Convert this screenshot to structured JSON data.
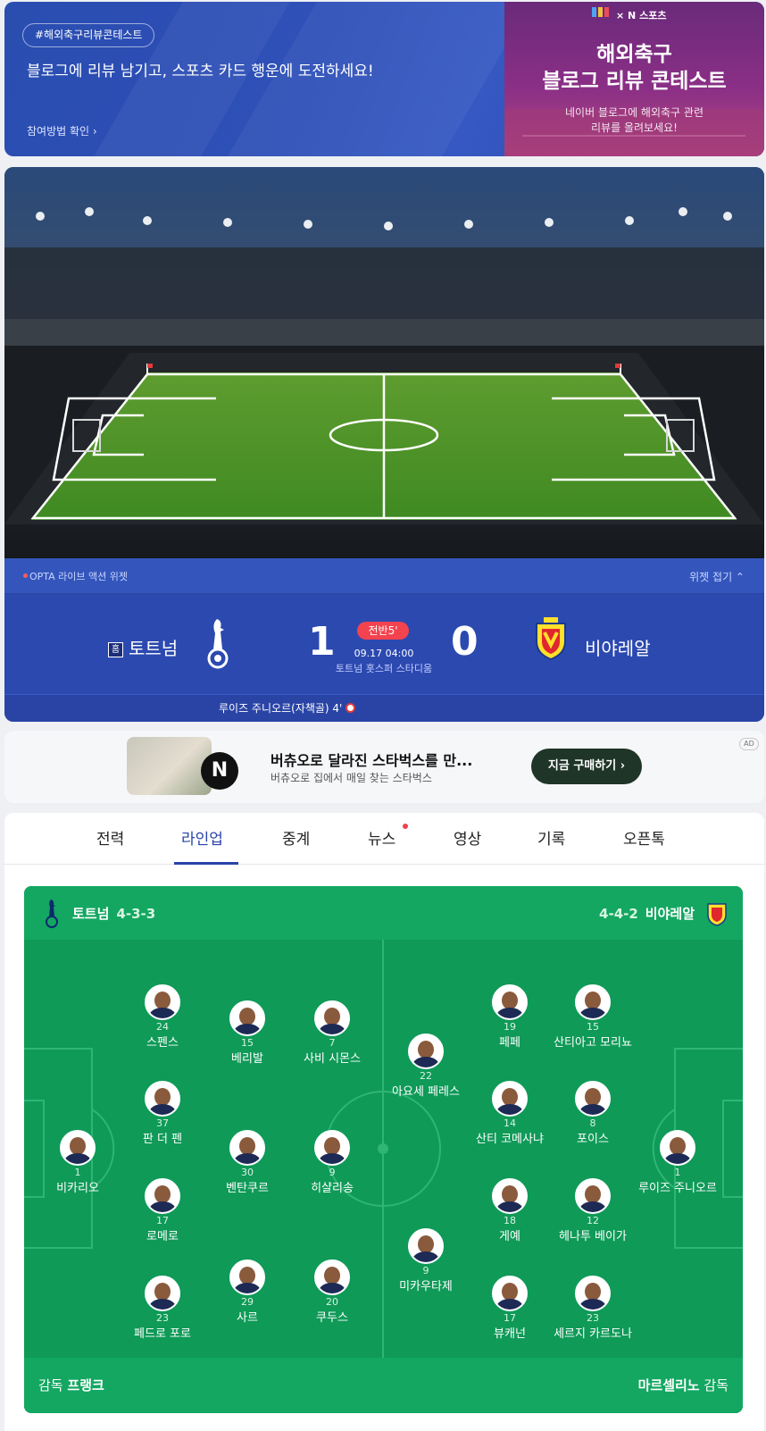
{
  "banner": {
    "tag": "#해외축구리뷰콘테스트",
    "headline": "블로그에 리뷰 남기고, 스포츠 카드 행운에 도전하세요!",
    "link": "참여방법 확인 ›",
    "promo_brand": "× N 스포츠",
    "promo_title_1": "해외축구",
    "promo_title_2": "블로그 리뷰 콘테스트",
    "promo_sub_1": "네이버 블로그에 해외축구 관련",
    "promo_sub_2": "리뷰를 올려보세요!"
  },
  "widget": {
    "label": "OPTA 라이브 액션 위젯",
    "fold": "위젯 접기 ⌃"
  },
  "match": {
    "home_badge": "홈",
    "home_team": "토트넘",
    "away_team": "비야레알",
    "home_score": "1",
    "away_score": "0",
    "status": "전반5'",
    "kickoff": "09.17 04:00",
    "venue": "토트넘 홋스퍼 스타디움",
    "scorer": "루이즈 주니오르(자책골) 4'"
  },
  "ad": {
    "title": "버츄오로 달라진 스타벅스를 만...",
    "desc": "버츄오로 집에서 매일 찾는 스타벅스",
    "button": "지금 구매하기 ›",
    "tag": "AD",
    "logo": "N"
  },
  "tabs": [
    "전력",
    "라인업",
    "중계",
    "뉴스",
    "영상",
    "기록",
    "오픈톡"
  ],
  "active_tab": "라인업",
  "lineup": {
    "home_team": "토트넘",
    "home_formation": "4-3-3",
    "away_team": "비야레알",
    "away_formation": "4-4-2",
    "home_coach_label": "감독",
    "home_coach": "프랭크",
    "away_coach_label": "감독",
    "away_coach": "마르셀리노",
    "home_players": [
      {
        "number": "24",
        "name": "스펜스"
      },
      {
        "number": "15",
        "name": "베리발"
      },
      {
        "number": "7",
        "name": "사비 시몬스"
      },
      {
        "number": "37",
        "name": "판 더 펜"
      },
      {
        "number": "1",
        "name": "비카리오"
      },
      {
        "number": "30",
        "name": "벤탄쿠르"
      },
      {
        "number": "9",
        "name": "히샬리송"
      },
      {
        "number": "17",
        "name": "로메로"
      },
      {
        "number": "29",
        "name": "사르"
      },
      {
        "number": "20",
        "name": "쿠두스"
      },
      {
        "number": "23",
        "name": "페드로 포로"
      }
    ],
    "away_players": [
      {
        "number": "19",
        "name": "페페"
      },
      {
        "number": "15",
        "name": "산티아고 모리뇨"
      },
      {
        "number": "22",
        "name": "아요세 페레스"
      },
      {
        "number": "14",
        "name": "산티 코메사냐"
      },
      {
        "number": "8",
        "name": "포이스"
      },
      {
        "number": "1",
        "name": "루이즈 주니오르"
      },
      {
        "number": "18",
        "name": "게예"
      },
      {
        "number": "12",
        "name": "헤나투 베이가"
      },
      {
        "number": "9",
        "name": "미카우타제"
      },
      {
        "number": "17",
        "name": "뷰캐넌"
      },
      {
        "number": "23",
        "name": "세르지 카르도나"
      }
    ]
  },
  "colors": {
    "primary_blue": "#2c49b0",
    "pitch_green": "#0f9a58",
    "live_red": "#f3434f",
    "tab_active": "#2a44a8"
  }
}
